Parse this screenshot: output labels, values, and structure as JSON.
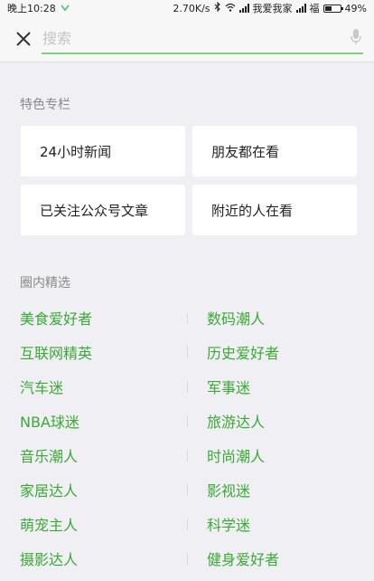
{
  "status_bar": {
    "time": "晚上10:28",
    "speed": "2.70K/s",
    "carrier1": "我爱我家",
    "carrier2": "福",
    "battery_text": "49%",
    "battery_level": 0.49
  },
  "search": {
    "placeholder": "搜索",
    "value": ""
  },
  "featured": {
    "title": "特色专栏",
    "cards": [
      "24小时新闻",
      "朋友都在看",
      "已关注公众号文章",
      "附近的人在看"
    ]
  },
  "circles": {
    "title": "圈内精选",
    "items": [
      [
        "美食爱好者",
        "数码潮人"
      ],
      [
        "互联网精英",
        "历史爱好者"
      ],
      [
        "汽车迷",
        "军事迷"
      ],
      [
        "NBA球迷",
        "旅游达人"
      ],
      [
        "音乐潮人",
        "时尚潮人"
      ],
      [
        "家居达人",
        "影视迷"
      ],
      [
        "萌宠主人",
        "科学迷"
      ],
      [
        "摄影达人",
        "健身爱好者"
      ]
    ]
  },
  "colors": {
    "accent_green": "#3aaa35",
    "underline_green": "#7ed37a",
    "background": "#efeff4"
  }
}
